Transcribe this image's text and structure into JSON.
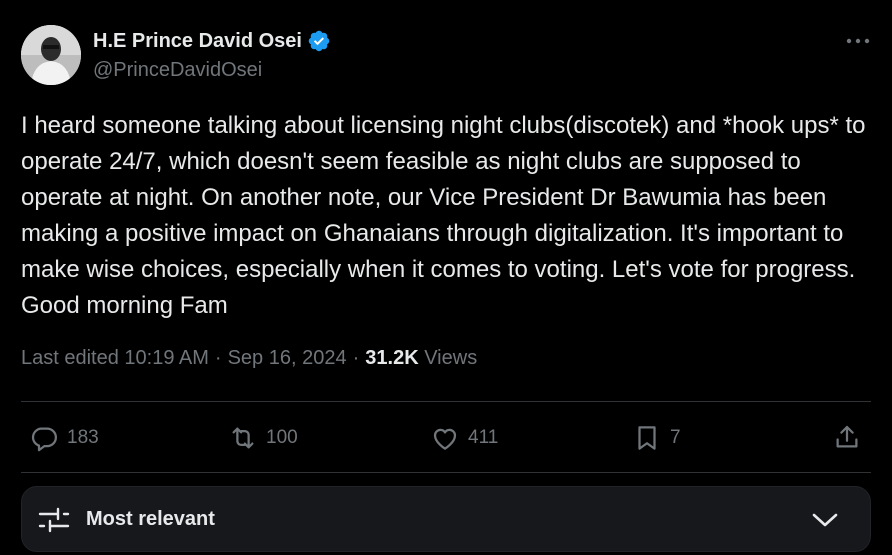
{
  "author": {
    "display_name": "H.E Prince David Osei",
    "handle": "@PrinceDavidOsei",
    "verified": true
  },
  "post": {
    "text": "I heard someone talking about licensing night clubs(discotek) and *hook ups* to operate 24/7, which doesn't seem feasible as night clubs are supposed to operate at night. On another note, our Vice President Dr Bawumia has been making a positive impact on Ghanaians through digitalization. It's important to make wise choices, especially when it comes to voting. Let's vote for progress. Good morning Fam"
  },
  "meta": {
    "edited_label": "Last edited 10:19 AM",
    "separator": "·",
    "date": "Sep 16, 2024",
    "views_count": "31.2K",
    "views_label": "Views"
  },
  "actions": {
    "replies": "183",
    "reposts": "100",
    "likes": "411",
    "bookmarks": "7"
  },
  "sort": {
    "label": "Most relevant"
  },
  "icons": {
    "more": "more-horizontal-icon",
    "verified": "verified-badge-icon",
    "reply": "reply-icon",
    "repost": "repost-icon",
    "like": "heart-icon",
    "bookmark": "bookmark-icon",
    "share": "share-icon",
    "sort": "sliders-icon",
    "chevron": "chevron-down-icon"
  },
  "colors": {
    "background": "#000000",
    "text": "#e7e9ea",
    "muted": "#71767b",
    "verified": "#1d9bf0",
    "divider": "#2f3336",
    "sort_bar": "#16181c"
  }
}
